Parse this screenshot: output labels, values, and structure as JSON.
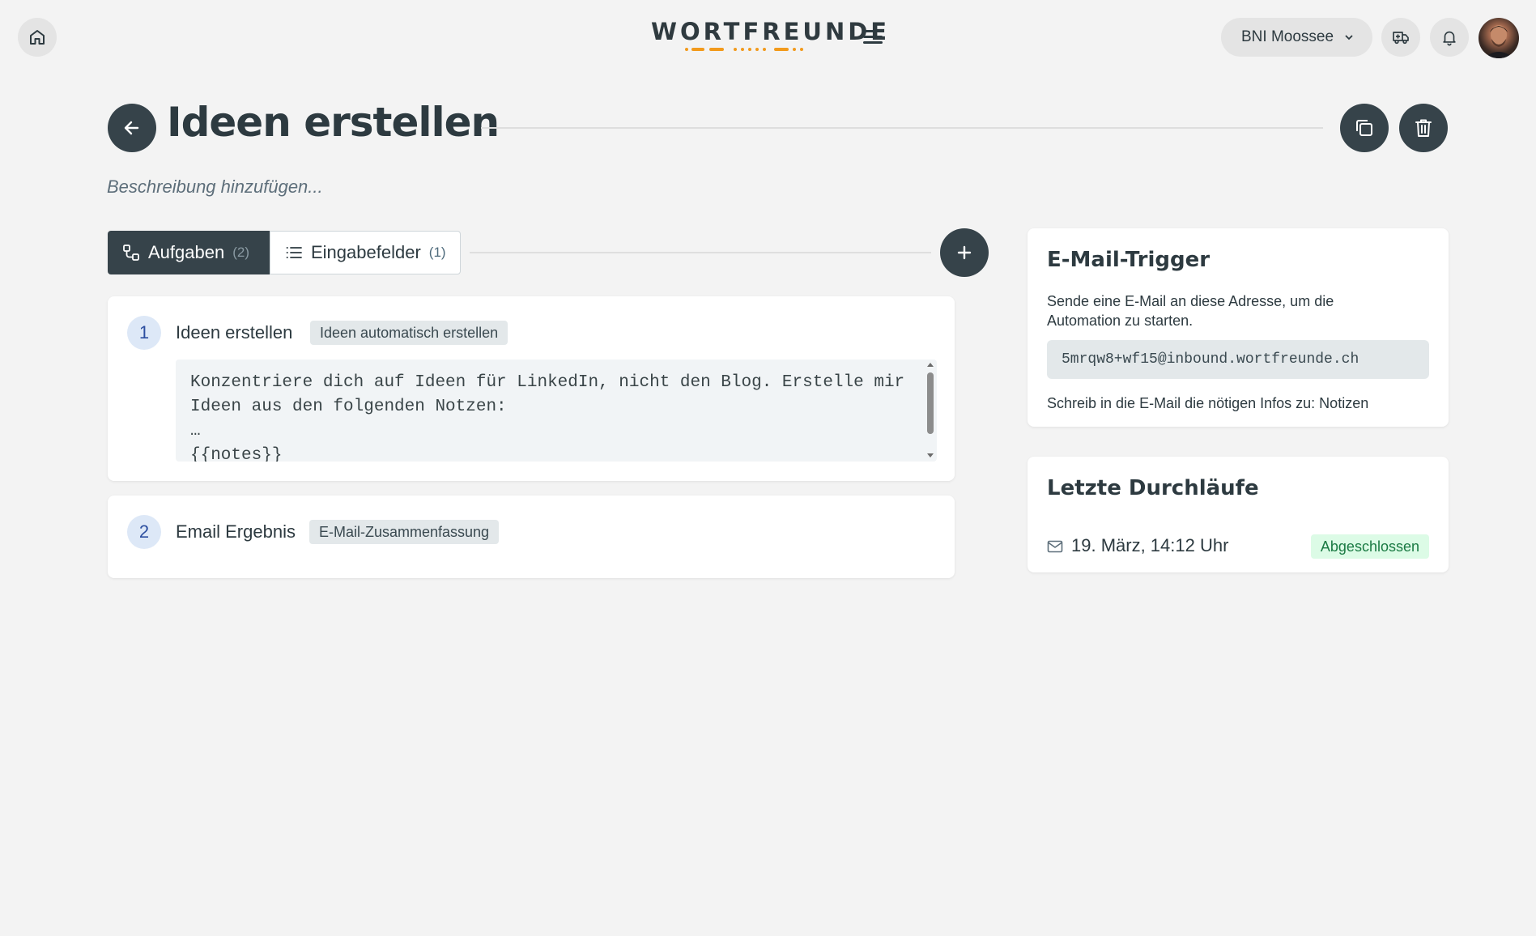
{
  "header": {
    "logo_text": "WORTFREUNDE",
    "org_name": "BNI Moossee"
  },
  "page": {
    "title": "Ideen erstellen",
    "description_placeholder": "Beschreibung hinzufügen..."
  },
  "tabs": [
    {
      "label": "Aufgaben",
      "count": "(2)"
    },
    {
      "label": "Eingabefelder",
      "count": "(1)"
    }
  ],
  "steps": [
    {
      "number": "1",
      "title": "Ideen erstellen",
      "badge": "Ideen automatisch erstellen",
      "prompt": "Konzentriere dich auf Ideen für LinkedIn, nicht den Blog. Erstelle mir Ideen aus den folgenden Notzen:\n…\n{{notes}}"
    },
    {
      "number": "2",
      "title": "Email Ergebnis",
      "badge": "E-Mail-Zusammenfassung"
    }
  ],
  "email_trigger": {
    "title": "E-Mail-Trigger",
    "intro": "Sende eine E-Mail an diese Adresse, um die Automation zu starten.",
    "address": "5mrqw8+wf15@inbound.wortfreunde.ch",
    "hint": "Schreib in die E-Mail die nötigen Infos zu: Notizen"
  },
  "recent_runs": {
    "title": "Letzte Durchläufe",
    "items": [
      {
        "date": "19. März, 14:12 Uhr",
        "status": "Abgeschlossen",
        "icon": "mail-icon"
      }
    ]
  },
  "colors": {
    "dark": "#36434a",
    "accent": "#f29a1c",
    "success_bg": "#dcfbe6",
    "success_text": "#1a7a43"
  }
}
